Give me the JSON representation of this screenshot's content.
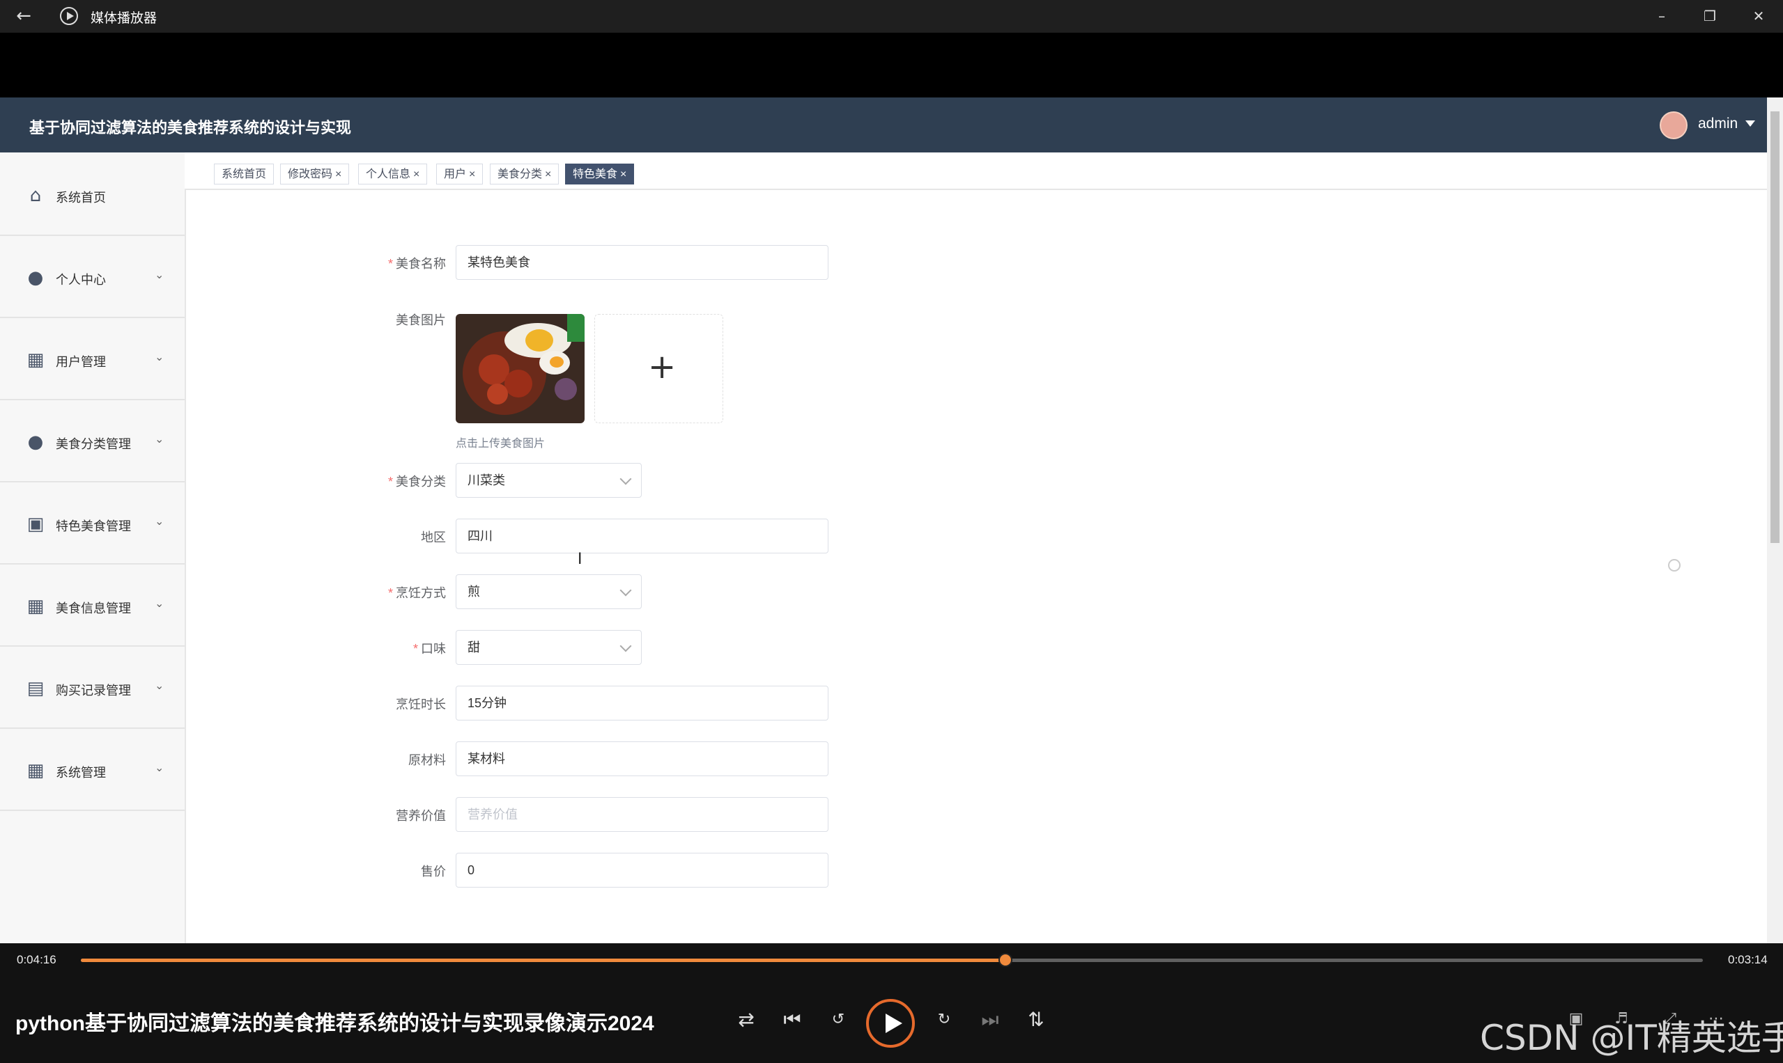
{
  "window": {
    "title": "媒体播放器"
  },
  "app": {
    "system_title": "基于协同过滤算法的美食推荐系统的设计与实现",
    "user": "admin"
  },
  "sidebar": {
    "items": [
      {
        "label": "系统首页",
        "icon": "home-icon"
      },
      {
        "label": "个人中心",
        "icon": "user-icon"
      },
      {
        "label": "用户管理",
        "icon": "grid-icon"
      },
      {
        "label": "美食分类管理",
        "icon": "user-icon"
      },
      {
        "label": "特色美食管理",
        "icon": "wallet-icon"
      },
      {
        "label": "美食信息管理",
        "icon": "grid-icon"
      },
      {
        "label": "购买记录管理",
        "icon": "clipboard-icon"
      },
      {
        "label": "系统管理",
        "icon": "grid-icon"
      }
    ]
  },
  "tabs": [
    {
      "label": "系统首页",
      "closable": false,
      "active": false
    },
    {
      "label": "修改密码",
      "closable": true,
      "active": false
    },
    {
      "label": "个人信息",
      "closable": true,
      "active": false
    },
    {
      "label": "用户",
      "closable": true,
      "active": false
    },
    {
      "label": "美食分类",
      "closable": true,
      "active": false
    },
    {
      "label": "特色美食",
      "closable": true,
      "active": true
    }
  ],
  "form": {
    "name": {
      "label": "美食名称",
      "value": "某特色美食"
    },
    "image": {
      "label": "美食图片",
      "hint": "点击上传美食图片"
    },
    "category": {
      "label": "美食分类",
      "value": "川菜类"
    },
    "region": {
      "label": "地区",
      "value": "四川"
    },
    "cooking_method": {
      "label": "烹饪方式",
      "value": "煎"
    },
    "taste": {
      "label": "口味",
      "value": "甜"
    },
    "cooking_time": {
      "label": "烹饪时长",
      "value": "15分钟"
    },
    "ingredients": {
      "label": "原材料",
      "value": "某材料"
    },
    "nutrition": {
      "label": "营养价值",
      "placeholder": "营养价值"
    },
    "price": {
      "label": "售价",
      "value": "0"
    }
  },
  "player": {
    "elapsed": "0:04:16",
    "remaining": "0:03:14",
    "progress": 0.57,
    "video_title": "python基于协同过滤算法的美食推荐系统的设计与实现录像演示2024",
    "watermark": "CSDN @IT精英选手",
    "accent_color": "#f08a3c"
  }
}
